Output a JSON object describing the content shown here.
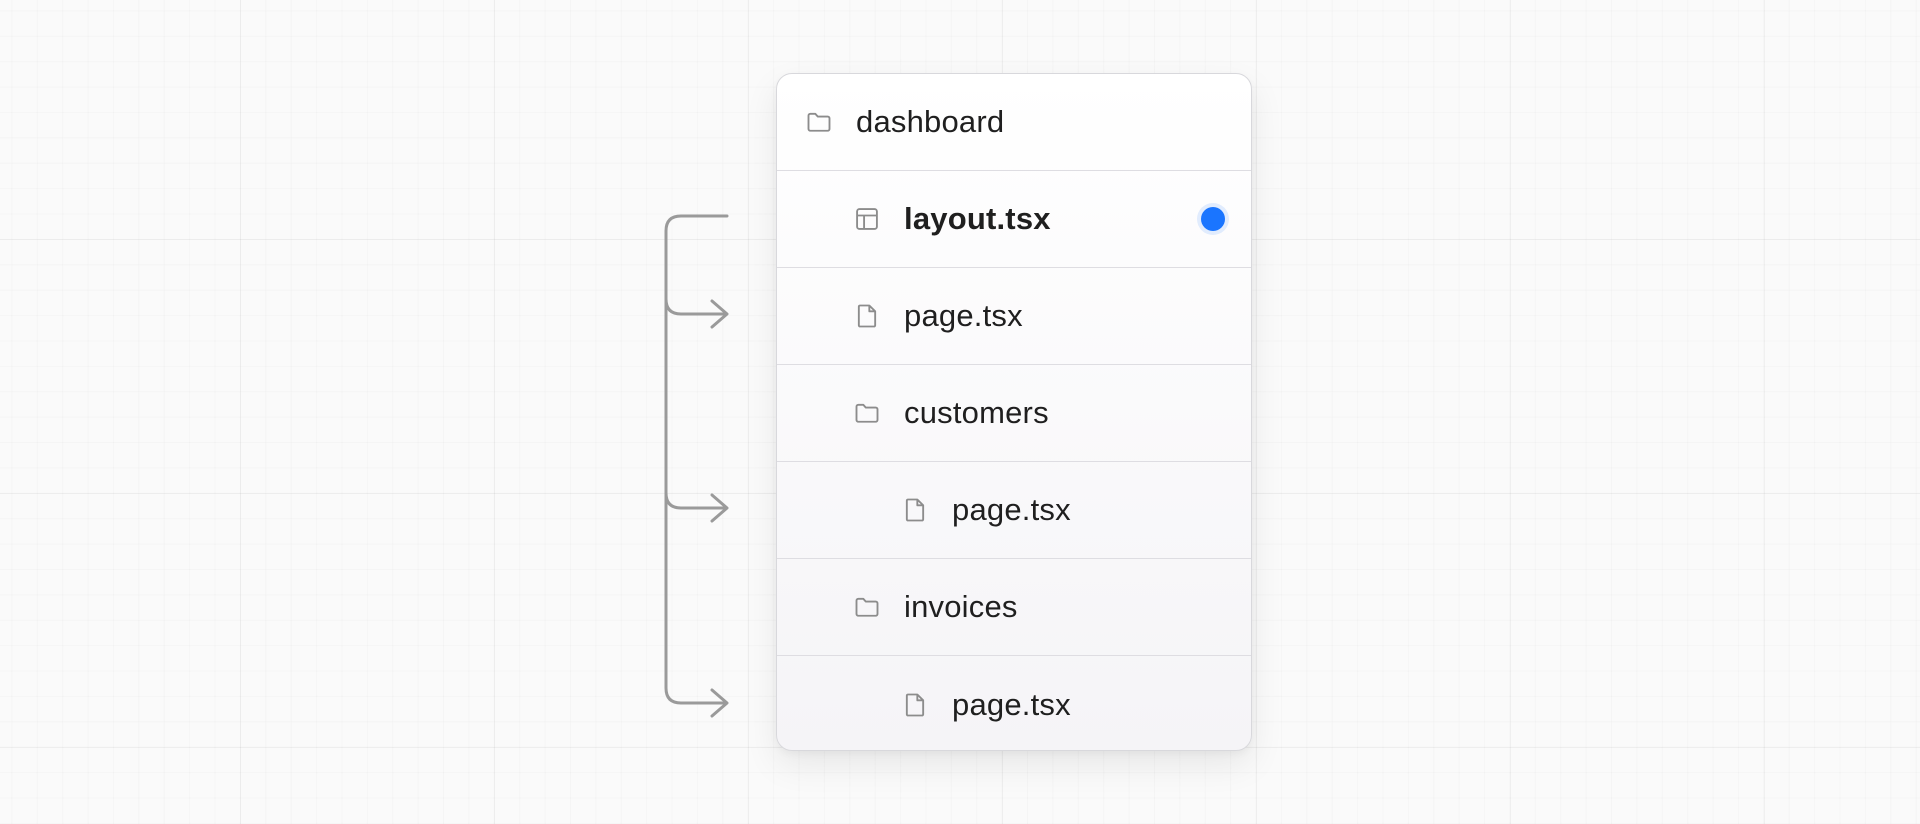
{
  "tree": {
    "items": [
      {
        "label": "dashboard",
        "icon": "folder-icon",
        "level": 0
      },
      {
        "label": "layout.tsx",
        "icon": "layout-icon",
        "level": 1,
        "active": true
      },
      {
        "label": "page.tsx",
        "icon": "file-icon",
        "level": 1
      },
      {
        "label": "customers",
        "icon": "folder-icon",
        "level": 1
      },
      {
        "label": "page.tsx",
        "icon": "file-icon",
        "level": 2
      },
      {
        "label": "invoices",
        "icon": "folder-icon",
        "level": 1
      },
      {
        "label": "page.tsx",
        "icon": "file-icon",
        "level": 2
      }
    ]
  },
  "colors": {
    "accent": "#1a75ff",
    "connector": "#9a9a9a",
    "icon": "#8c8c8c"
  }
}
